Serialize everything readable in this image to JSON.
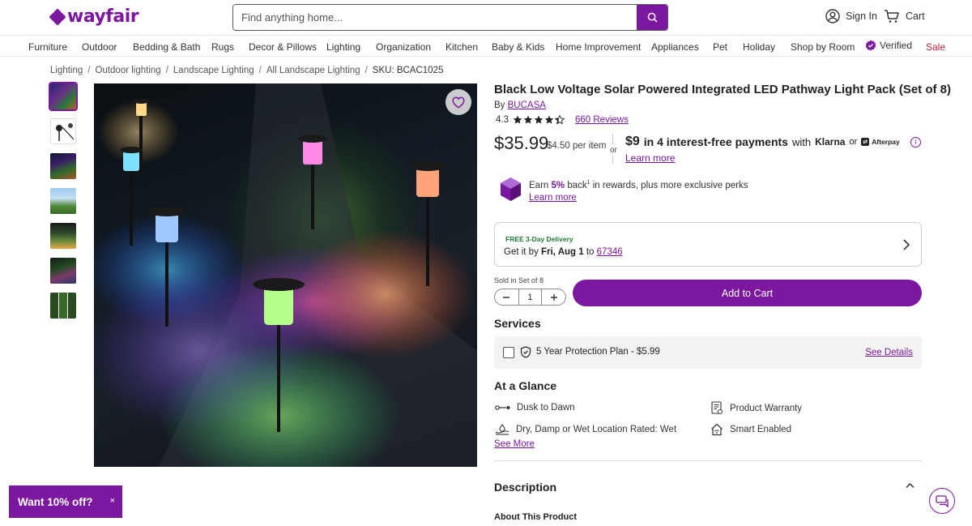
{
  "header": {
    "logo": "wayfair",
    "search_placeholder": "Find anything home...",
    "sign_in": "Sign In",
    "cart": "Cart"
  },
  "nav": {
    "items": [
      "Furniture",
      "Outdoor",
      "Bedding & Bath",
      "Rugs",
      "Decor & Pillows",
      "Lighting",
      "Organization",
      "Kitchen",
      "Baby & Kids",
      "Home Improvement",
      "Appliances",
      "Pet",
      "Holiday",
      "Shop by Room",
      "Verified",
      "Sale"
    ]
  },
  "breadcrumb": {
    "items": [
      "Lighting",
      "Outdoor lighting",
      "Landscape Lighting",
      "All Landscape Lighting"
    ],
    "separator": "/",
    "sku": "SKU: BCAC1025"
  },
  "product": {
    "title": "Black Low Voltage Solar Powered Integrated LED Pathway Light Pack (Set of 8)",
    "by_prefix": "By",
    "brand": "BUCASA",
    "rating": "4.3",
    "rating_stars_value": 4.3,
    "reviews": "660 Reviews",
    "price": "$35.99",
    "per_item": "$4.50 per item",
    "or": "or",
    "installment_amount": "$9",
    "installment_text": "in 4 interest-free payments",
    "with": "with",
    "klarna": "Klarna",
    "or2": "or",
    "afterpay": "Afterpay",
    "learn_more": "Learn more"
  },
  "rewards": {
    "earn": "Earn",
    "pct": "5%",
    "back": "back",
    "sup": "1",
    "rest": "in rewards, plus more exclusive perks",
    "learn_more": "Learn more"
  },
  "delivery": {
    "tag": "FREE 3-Day Delivery",
    "prefix": "Get it by",
    "date": "Fri, Aug 1",
    "to": "to",
    "zip": "67346"
  },
  "purchase": {
    "sold_in": "Sold in Set of 8",
    "qty": "1",
    "add_to_cart": "Add to Cart"
  },
  "services": {
    "heading": "Services",
    "plan": "5 Year Protection Plan - $5.99",
    "see_details": "See Details"
  },
  "glance": {
    "heading": "At a Glance",
    "items": [
      "Dusk to Dawn",
      "Dry, Damp or Wet Location Rated: Wet",
      "Product Warranty",
      "Smart Enabled"
    ],
    "see_more": "See More"
  },
  "description": {
    "heading": "Description",
    "about": "About This Product"
  },
  "promo": {
    "label": "Want 10% off?",
    "close": "×"
  },
  "colors": {
    "brand": "#7b189f",
    "delivery_green": "#1e7a36"
  }
}
